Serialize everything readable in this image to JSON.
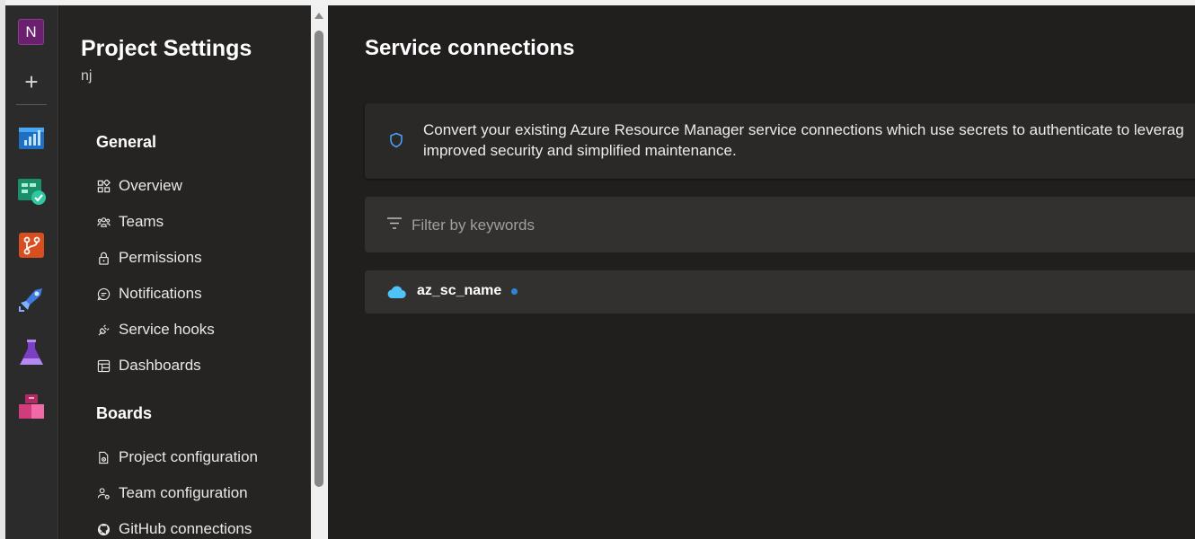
{
  "rail": {
    "org_initial": "N",
    "items": [
      {
        "name": "overview-icon",
        "color": "#2f8de4"
      },
      {
        "name": "boards-icon",
        "color": "#1fa67a"
      },
      {
        "name": "repos-icon",
        "color": "#e05c2a"
      },
      {
        "name": "pipelines-icon",
        "color": "#2f6fdb"
      },
      {
        "name": "test-plans-icon",
        "color": "#8a4fd8"
      },
      {
        "name": "artifacts-icon",
        "color": "#d73b7e"
      }
    ]
  },
  "sidebar": {
    "title": "Project Settings",
    "project": "nj",
    "general_header": "General",
    "general_items": [
      {
        "label": "Overview",
        "icon": "overview-icon"
      },
      {
        "label": "Teams",
        "icon": "teams-icon"
      },
      {
        "label": "Permissions",
        "icon": "lock-icon"
      },
      {
        "label": "Notifications",
        "icon": "chat-icon"
      },
      {
        "label": "Service hooks",
        "icon": "plug-icon"
      },
      {
        "label": "Dashboards",
        "icon": "dashboard-icon"
      }
    ],
    "boards_header": "Boards",
    "boards_items": [
      {
        "label": "Project configuration",
        "icon": "doc-gear-icon"
      },
      {
        "label": "Team configuration",
        "icon": "people-gear-icon"
      },
      {
        "label": "GitHub connections",
        "icon": "github-icon"
      }
    ]
  },
  "main": {
    "title": "Service connections",
    "banner_line1": "Convert your existing Azure Resource Manager service connections which use secrets to authenticate to leverag",
    "banner_line2": "improved security and simplified maintenance.",
    "filter_placeholder": "Filter by keywords",
    "connections": [
      {
        "name": "az_sc_name",
        "icon": "cloud-icon"
      }
    ]
  },
  "colors": {
    "accent": "#2b88d8",
    "cloud": "#4fc3f7"
  }
}
